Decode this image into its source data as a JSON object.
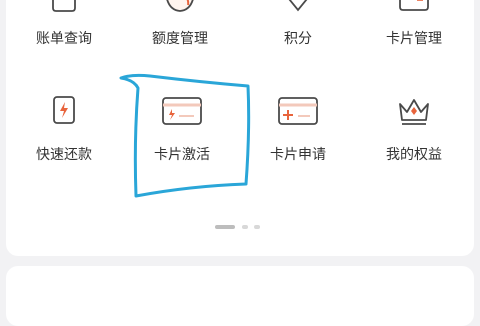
{
  "menu": {
    "row1": [
      {
        "label": "账单查询",
        "icon": "bill-icon"
      },
      {
        "label": "额度管理",
        "icon": "egg-icon"
      },
      {
        "label": "积分",
        "icon": "points-icon"
      },
      {
        "label": "卡片管理",
        "icon": "card-manage-icon"
      }
    ],
    "row2": [
      {
        "label": "快速还款",
        "icon": "lightning-icon"
      },
      {
        "label": "卡片激活",
        "icon": "card-activate-icon"
      },
      {
        "label": "卡片申请",
        "icon": "card-apply-icon"
      },
      {
        "label": "我的权益",
        "icon": "crown-icon"
      }
    ]
  },
  "pager": {
    "pages": 3,
    "current_page": 1
  },
  "colors": {
    "accent": "#e8643c",
    "annotation": "#2aa6d8",
    "text": "#333333"
  }
}
